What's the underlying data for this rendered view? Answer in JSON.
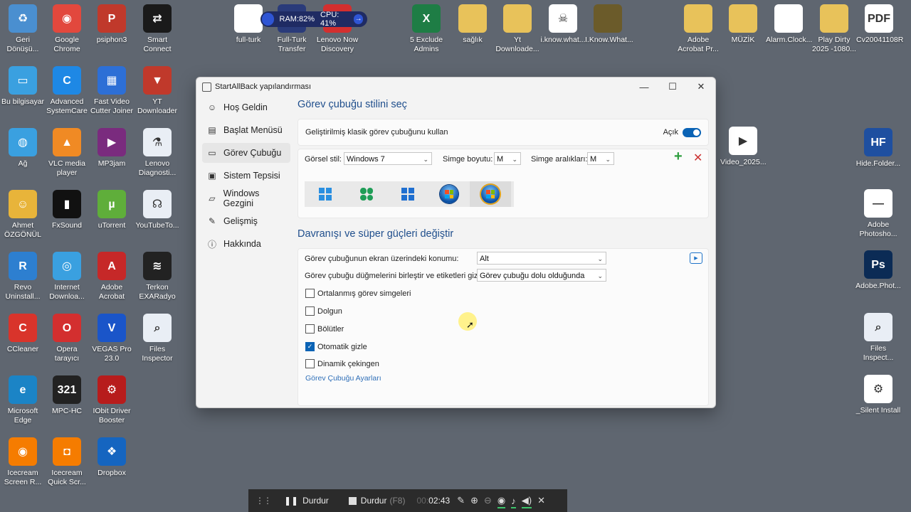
{
  "desktop": {
    "icons": [
      {
        "label": "Geri Dönüşü...",
        "color": "#4a8fd0",
        "glyph": "recycle-bin-icon",
        "sym": "♻"
      },
      {
        "label": "Google Chrome",
        "color": "#e2483d",
        "glyph": "chrome-icon",
        "sym": "◉"
      },
      {
        "label": "psiphon3",
        "color": "#c0392b",
        "glyph": "psiphon-icon",
        "sym": "P"
      },
      {
        "label": "Smart Connect",
        "color": "#1a1a1a",
        "glyph": "smart-connect-icon",
        "sym": "⇄"
      },
      {
        "label": "Bu bilgisayar",
        "color": "#3aa0e0",
        "glyph": "computer-icon",
        "sym": "▭"
      },
      {
        "label": "Advanced SystemCare",
        "color": "#1e88e5",
        "glyph": "advanced-systemcare-icon",
        "sym": "C"
      },
      {
        "label": "Fast Video Cutter Joiner",
        "color": "#2d6fd6",
        "glyph": "video-cutter-icon",
        "sym": "▦"
      },
      {
        "label": "YT Downloader",
        "color": "#c0392b",
        "glyph": "yt-downloader-icon",
        "sym": "▼"
      },
      {
        "label": "Ağ",
        "color": "#3aa0e0",
        "glyph": "network-icon",
        "sym": "◍"
      },
      {
        "label": "VLC media player",
        "color": "#f08a24",
        "glyph": "vlc-icon",
        "sym": "▲"
      },
      {
        "label": "MP3jam",
        "color": "#7a2b7e",
        "glyph": "mp3jam-icon",
        "sym": "▶"
      },
      {
        "label": "Lenovo Diagnosti...",
        "color": "#e9eef5",
        "glyph": "lenovo-diagnostics-icon",
        "sym": "⚗"
      },
      {
        "label": "Ahmet ÖZGÖNÜL",
        "color": "#e8b43a",
        "glyph": "user-folder-icon",
        "sym": "☺"
      },
      {
        "label": "FxSound",
        "color": "#111111",
        "glyph": "fxsound-icon",
        "sym": "▮"
      },
      {
        "label": "uTorrent",
        "color": "#5fae3a",
        "glyph": "utorrent-icon",
        "sym": "µ"
      },
      {
        "label": "YouTubeTo...",
        "color": "#e9eef5",
        "glyph": "youtube-to-icon",
        "sym": "☊"
      },
      {
        "label": "Revo Uninstall...",
        "color": "#2d7fd0",
        "glyph": "revo-uninstaller-icon",
        "sym": "R"
      },
      {
        "label": "Internet Downloa...",
        "color": "#3aa0e0",
        "glyph": "internet-download-manager-icon",
        "sym": "◎"
      },
      {
        "label": "Adobe Acrobat",
        "color": "#c62828",
        "glyph": "acrobat-icon",
        "sym": "A"
      },
      {
        "label": "Terkon EXARadyo",
        "color": "#222222",
        "glyph": "radio-icon",
        "sym": "≋"
      },
      {
        "label": "CCleaner",
        "color": "#d9342b",
        "glyph": "ccleaner-icon",
        "sym": "C"
      },
      {
        "label": "Opera tarayıcı",
        "color": "#d32f2f",
        "glyph": "opera-icon",
        "sym": "O"
      },
      {
        "label": "VEGAS Pro 23.0",
        "color": "#1a55c9",
        "glyph": "vegas-pro-icon",
        "sym": "V"
      },
      {
        "label": "Files Inspector",
        "color": "#e9eef5",
        "glyph": "files-inspector-icon",
        "sym": "⌕"
      },
      {
        "label": "Microsoft Edge",
        "color": "#1b84c6",
        "glyph": "edge-icon",
        "sym": "e"
      },
      {
        "label": "MPC-HC",
        "color": "#222222",
        "glyph": "mpc-hc-icon",
        "sym": "321"
      },
      {
        "label": "IObit Driver Booster",
        "color": "#b71c1c",
        "glyph": "driver-booster-icon",
        "sym": "⚙"
      },
      {
        "label": "",
        "color": "transparent",
        "glyph": "empty",
        "sym": ""
      },
      {
        "label": "Icecream Screen R...",
        "color": "#f57c00",
        "glyph": "icecream-recorder-icon",
        "sym": "◉"
      },
      {
        "label": "Icecream Quick Scr...",
        "color": "#f57c00",
        "glyph": "icecream-screenshot-icon",
        "sym": "◘"
      },
      {
        "label": "Dropbox",
        "color": "#1565c0",
        "glyph": "dropbox-icon",
        "sym": "❖"
      }
    ],
    "top_icons": [
      {
        "label": "full-turk",
        "color": "#ffffff",
        "glyph": "file-thumbnail-icon",
        "sym": ""
      },
      {
        "label": "Full-Turk Transfer",
        "color": "#2a3b7a",
        "glyph": "transfer-icon",
        "sym": "⇆"
      },
      {
        "label": "Lenovo Now Discovery",
        "color": "#d32f2f",
        "glyph": "lenovo-now-icon",
        "sym": "L"
      },
      {
        "label": "5 Exclude Admins",
        "color": "#1e7d45",
        "glyph": "excel-icon",
        "sym": "X"
      },
      {
        "label": "sağlık",
        "color": "#e8c25a",
        "glyph": "folder-icon",
        "sym": ""
      },
      {
        "label": "Yt Downloade...",
        "color": "#e8c25a",
        "glyph": "folder-icon",
        "sym": ""
      },
      {
        "label": "i.know.what...",
        "color": "#ffffff",
        "glyph": "video-thumbnail-icon",
        "sym": "☠"
      },
      {
        "label": "I.Know.What...",
        "color": "#6b5b2a",
        "glyph": "folder-movie-icon",
        "sym": ""
      },
      {
        "label": "Adobe Acrobat Pr...",
        "color": "#e8c25a",
        "glyph": "folder-icon",
        "sym": ""
      },
      {
        "label": "MÜZİK",
        "color": "#e8c25a",
        "glyph": "folder-icon",
        "sym": ""
      },
      {
        "label": "Alarm.Clock...",
        "color": "#ffffff",
        "glyph": "file-icon",
        "sym": ""
      },
      {
        "label": "Play Dirty 2025 -1080...",
        "color": "#e8c25a",
        "glyph": "folder-movie-icon",
        "sym": ""
      },
      {
        "label": "Cv20041108R",
        "color": "#ffffff",
        "glyph": "pdf-icon",
        "sym": "PDF"
      }
    ],
    "right_icons": [
      {
        "label": "Video_2025...",
        "color": "#ffffff",
        "glyph": "video-file-icon",
        "sym": "▶"
      },
      {
        "label": "Hide.Folder...",
        "color": "#1e4fa0",
        "glyph": "hide-folder-icon",
        "sym": "HF"
      },
      {
        "label": "Adobe Photosho...",
        "color": "#ffffff",
        "glyph": "file-icon",
        "sym": "—"
      },
      {
        "label": "Adobe.Phot...",
        "color": "#0b2b55",
        "glyph": "photoshop-icon",
        "sym": "Ps"
      },
      {
        "label": "Files Inspect...",
        "color": "#e9eef5",
        "glyph": "files-inspector-icon",
        "sym": "⌕"
      },
      {
        "label": "_Silent Install",
        "color": "#ffffff",
        "glyph": "settings-file-icon",
        "sym": "⚙"
      }
    ]
  },
  "perf": {
    "ram": "RAM:82%",
    "cpu": "CPU: 41%"
  },
  "window": {
    "title": "StartAllBack yapılandırması",
    "nav": [
      {
        "label": "Hoş Geldin",
        "icon": "smile-icon",
        "sym": "☺"
      },
      {
        "label": "Başlat Menüsü",
        "icon": "start-menu-icon",
        "sym": "▤"
      },
      {
        "label": "Görev Çubuğu",
        "icon": "taskbar-icon",
        "sym": "▭"
      },
      {
        "label": "Sistem Tepsisi",
        "icon": "tray-icon",
        "sym": "▣"
      },
      {
        "label": "Windows Gezgini",
        "icon": "folder-icon",
        "sym": "▱"
      },
      {
        "label": "Gelişmiş",
        "icon": "wrench-icon",
        "sym": "✎"
      },
      {
        "label": "Hakkında",
        "icon": "info-icon",
        "sym": "ⓘ"
      }
    ],
    "section1_title": "Görev çubuğu stilini seç",
    "classic_label": "Geliştirilmiş klasik görev çubuğunu kullan",
    "toggle_label": "Açık",
    "visual_style_label": "Görsel stil:",
    "visual_style_value": "Windows 7",
    "icon_size_label": "Simge boyutu:",
    "icon_size_value": "M",
    "icon_spacing_label": "Simge aralıkları:",
    "icon_spacing_value": "M",
    "section2_title": "Davranışı ve süper güçleri değiştir",
    "position_label": "Görev çubuğunun ekran üzerindeki konumu:",
    "position_value": "Alt",
    "combine_label": "Görev çubuğu düğmelerini birleştir ve etiketleri gizle:",
    "combine_value": "Görev çubuğu dolu olduğunda",
    "checkboxes": [
      {
        "label": "Ortalanmış görev simgeleri",
        "checked": false
      },
      {
        "label": "Dolgun",
        "checked": false
      },
      {
        "label": "Bölütler",
        "checked": false
      },
      {
        "label": "Otomatik gizle",
        "checked": true
      },
      {
        "label": "Dinamik çekingen",
        "checked": false
      }
    ],
    "settings_link": "Görev Çubuğu Ayarları"
  },
  "recorder": {
    "pause_label": "Durdur",
    "stop_label": "Durdur",
    "stop_hotkey": "(F8)",
    "time_prefix": "00:",
    "time": "02:43"
  }
}
